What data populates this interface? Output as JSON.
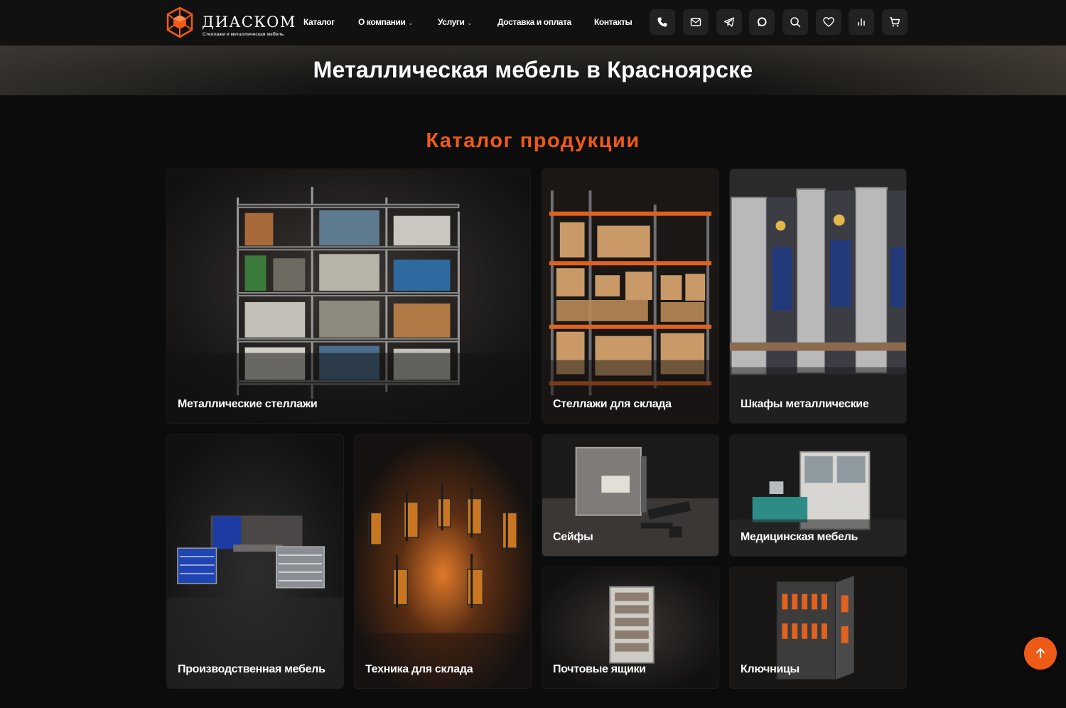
{
  "brand": {
    "name": "ДИАСКОМ",
    "tagline": "Стеллажи и металлическая мебель",
    "accent_color": "#f05a17"
  },
  "nav": {
    "items": [
      {
        "label": "Каталог",
        "has_dropdown": false
      },
      {
        "label": "О компании",
        "has_dropdown": true
      },
      {
        "label": "Услуги",
        "has_dropdown": true
      },
      {
        "label": "Доставка и оплата",
        "has_dropdown": false
      },
      {
        "label": "Контакты",
        "has_dropdown": false
      }
    ],
    "icons": [
      "phone-icon",
      "mail-icon",
      "telegram-icon",
      "chat-icon",
      "search-icon",
      "heart-icon",
      "compare-icon",
      "cart-icon"
    ]
  },
  "hero": {
    "title": "Металлическая мебель в Красноярске"
  },
  "catalog": {
    "title": "Каталог продукции",
    "cards": [
      {
        "label": "Металлические стеллажи"
      },
      {
        "label": "Стеллажи для склада"
      },
      {
        "label": "Шкафы металлические"
      },
      {
        "label": "Производственная мебель"
      },
      {
        "label": "Техника для склада"
      },
      {
        "label": "Сейфы"
      },
      {
        "label": "Медицинская мебель"
      },
      {
        "label": "Почтовые ящики"
      },
      {
        "label": "Ключницы"
      }
    ]
  },
  "scroll_top": {
    "icon": "arrow-up-icon"
  }
}
